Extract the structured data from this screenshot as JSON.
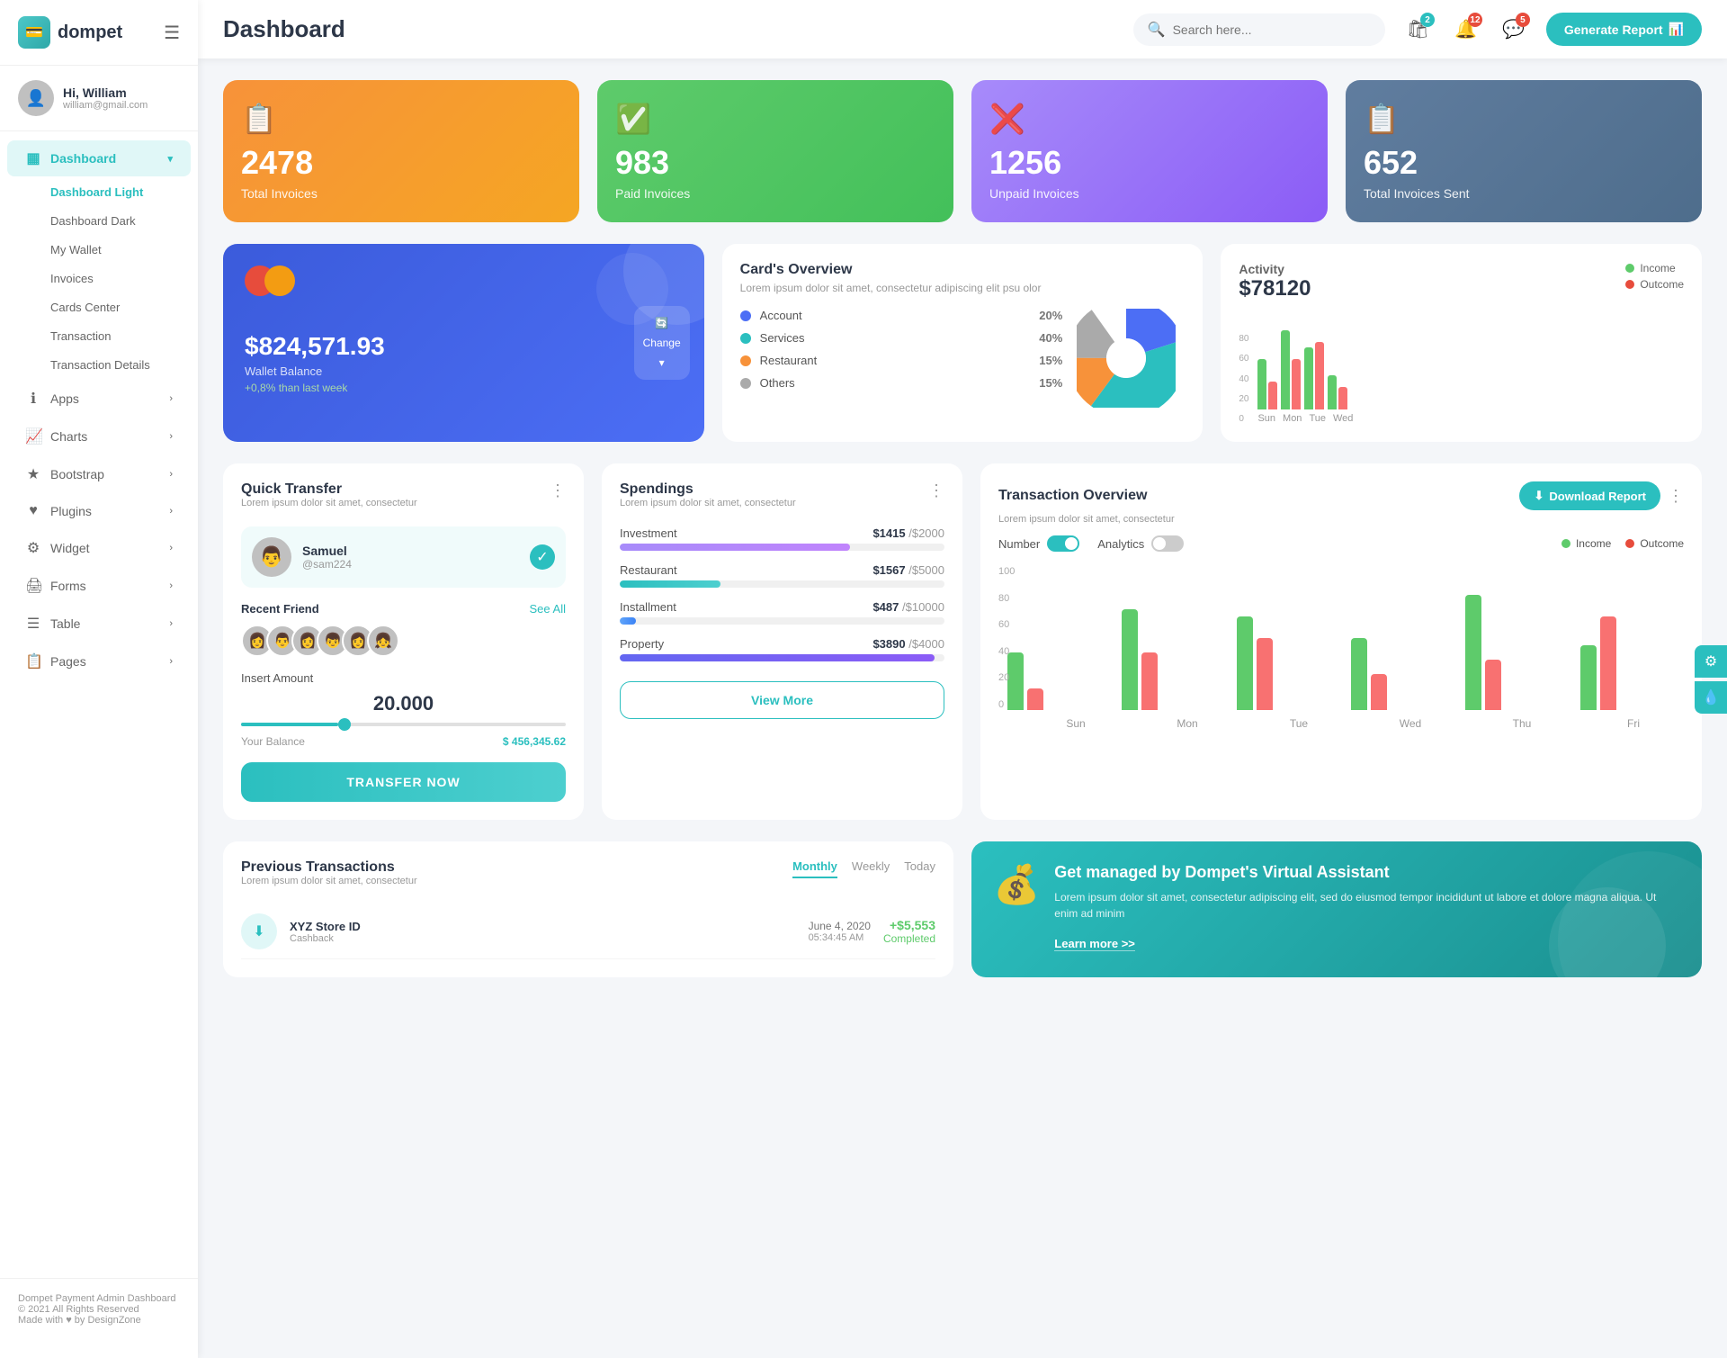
{
  "app": {
    "name": "dompet",
    "title": "Dashboard"
  },
  "sidebar": {
    "logo": "💼",
    "user": {
      "greeting": "Hi, William",
      "email": "william@gmail.com"
    },
    "nav": [
      {
        "id": "dashboard",
        "icon": "▦",
        "label": "Dashboard",
        "active": true,
        "hasArrow": true
      },
      {
        "id": "apps",
        "icon": "ℹ",
        "label": "Apps",
        "hasArrow": true
      },
      {
        "id": "charts",
        "icon": "📈",
        "label": "Charts",
        "hasArrow": true
      },
      {
        "id": "bootstrap",
        "icon": "★",
        "label": "Bootstrap",
        "hasArrow": true
      },
      {
        "id": "plugins",
        "icon": "♥",
        "label": "Plugins",
        "hasArrow": true
      },
      {
        "id": "widget",
        "icon": "⚙",
        "label": "Widget",
        "hasArrow": true
      },
      {
        "id": "forms",
        "icon": "🖨",
        "label": "Forms",
        "hasArrow": true
      },
      {
        "id": "table",
        "icon": "☰",
        "label": "Table",
        "hasArrow": true
      },
      {
        "id": "pages",
        "icon": "📋",
        "label": "Pages",
        "hasArrow": true
      }
    ],
    "sub_nav": [
      {
        "label": "Dashboard Light",
        "active": true
      },
      {
        "label": "Dashboard Dark"
      },
      {
        "label": "My Wallet"
      },
      {
        "label": "Invoices"
      },
      {
        "label": "Cards Center"
      },
      {
        "label": "Transaction"
      },
      {
        "label": "Transaction Details"
      }
    ],
    "footer": {
      "company": "Dompet Payment Admin Dashboard",
      "copyright": "© 2021 All Rights Reserved",
      "made_with": "Made with ♥ by DesignZone"
    }
  },
  "topbar": {
    "search_placeholder": "Search here...",
    "generate_btn": "Generate Report",
    "badge_cart": "2",
    "badge_bell": "12",
    "badge_msg": "5"
  },
  "stats": [
    {
      "id": "total",
      "number": "2478",
      "label": "Total Invoices",
      "icon": "📋",
      "color": "orange"
    },
    {
      "id": "paid",
      "number": "983",
      "label": "Paid Invoices",
      "icon": "✅",
      "color": "green"
    },
    {
      "id": "unpaid",
      "number": "1256",
      "label": "Unpaid Invoices",
      "icon": "❌",
      "color": "purple"
    },
    {
      "id": "sent",
      "number": "652",
      "label": "Total Invoices Sent",
      "icon": "📋",
      "color": "blue-gray"
    }
  ],
  "wallet": {
    "balance": "$824,571.93",
    "label": "Wallet Balance",
    "change": "+0,8% than last week",
    "change_btn": "Change"
  },
  "overview": {
    "title": "Card's Overview",
    "subtitle": "Lorem ipsum dolor sit amet, consectetur adipiscing elit psu olor",
    "items": [
      {
        "label": "Account",
        "pct": "20%",
        "color": "dot-blue"
      },
      {
        "label": "Services",
        "pct": "40%",
        "color": "dot-teal"
      },
      {
        "label": "Restaurant",
        "pct": "15%",
        "color": "dot-orange"
      },
      {
        "label": "Others",
        "pct": "15%",
        "color": "dot-gray"
      }
    ]
  },
  "activity": {
    "title": "Activity",
    "amount": "$78120",
    "income_label": "Income",
    "outcome_label": "Outcome",
    "bars": [
      {
        "day": "Sun",
        "income": 45,
        "outcome": 25
      },
      {
        "day": "Mon",
        "income": 70,
        "outcome": 45
      },
      {
        "day": "Tue",
        "income": 55,
        "outcome": 60
      },
      {
        "day": "Wed",
        "income": 30,
        "outcome": 20
      }
    ]
  },
  "quick_transfer": {
    "title": "Quick Transfer",
    "subtitle": "Lorem ipsum dolor sit amet, consectetur",
    "contact": {
      "name": "Samuel",
      "handle": "@sam224",
      "avatar": "👨"
    },
    "recent_label": "Recent Friend",
    "see_all": "See All",
    "friends": [
      "👩",
      "👨",
      "👩",
      "👦",
      "👩",
      "👧"
    ],
    "insert_amount_label": "Insert Amount",
    "amount": "20.000",
    "balance_label": "Your Balance",
    "balance": "$ 456,345.62",
    "transfer_btn": "TRANSFER NOW"
  },
  "spendings": {
    "title": "Spendings",
    "subtitle": "Lorem ipsum dolor sit amet, consectetur",
    "items": [
      {
        "label": "Investment",
        "amount": "$1415",
        "total": "$2000",
        "fill_class": "fill-purple",
        "pct": 71
      },
      {
        "label": "Restaurant",
        "amount": "$1567",
        "total": "$5000",
        "fill_class": "fill-teal",
        "pct": 31
      },
      {
        "label": "Installment",
        "amount": "$487",
        "total": "$10000",
        "fill_class": "fill-blue",
        "pct": 5
      },
      {
        "label": "Property",
        "amount": "$3890",
        "total": "$4000",
        "fill_class": "fill-indigo",
        "pct": 97
      }
    ],
    "view_more_btn": "View More"
  },
  "transaction_overview": {
    "title": "Transaction Overview",
    "subtitle": "Lorem ipsum dolor sit amet, consectetur",
    "download_btn": "Download Report",
    "number_label": "Number",
    "analytics_label": "Analytics",
    "income_label": "Income",
    "outcome_label": "Outcome",
    "bars": [
      {
        "day": "Sun",
        "income": 40,
        "outcome": 15
      },
      {
        "day": "Mon",
        "income": 70,
        "outcome": 40
      },
      {
        "day": "Tue",
        "income": 65,
        "outcome": 50
      },
      {
        "day": "Wed",
        "income": 50,
        "outcome": 25
      },
      {
        "day": "Thu",
        "income": 80,
        "outcome": 35
      },
      {
        "day": "Fri",
        "income": 45,
        "outcome": 65
      }
    ],
    "y_labels": [
      "100",
      "80",
      "60",
      "40",
      "20",
      "0"
    ]
  },
  "prev_transactions": {
    "title": "Previous Transactions",
    "subtitle": "Lorem ipsum dolor sit amet, consectetur",
    "tabs": [
      "Monthly",
      "Weekly",
      "Today"
    ],
    "active_tab": "Monthly",
    "rows": [
      {
        "name": "XYZ Store ID",
        "sub": "Cashback",
        "date": "June 4, 2020",
        "time": "05:34:45 AM",
        "amount": "+$5,553",
        "status": "Completed",
        "icon": "⬇"
      }
    ]
  },
  "promo": {
    "icon": "💰",
    "title": "Get managed by Dompet's Virtual Assistant",
    "text": "Lorem ipsum dolor sit amet, consectetur adipiscing elit, sed do eiusmod tempor incididunt ut labore et dolore magna aliqua. Ut enim ad minim",
    "link": "Learn more >>"
  }
}
